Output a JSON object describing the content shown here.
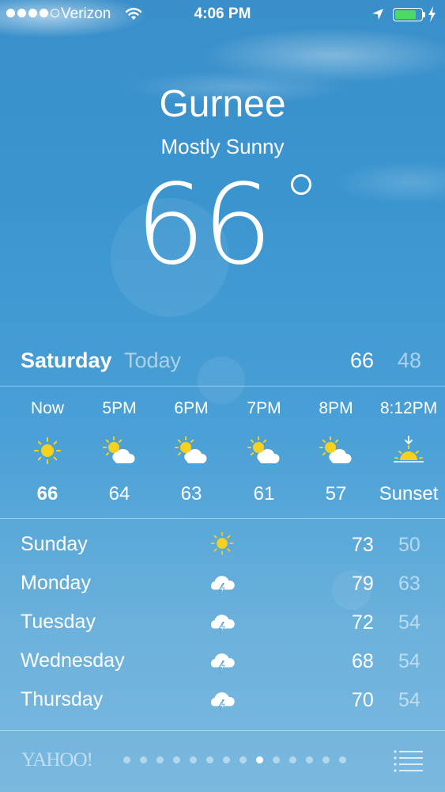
{
  "status_bar": {
    "carrier": "Verizon",
    "time": "4:06 PM",
    "battery_level": 0.85,
    "battery_color": "#4cd964",
    "signal_dots_filled": 4,
    "signal_dots_total": 5
  },
  "header": {
    "city": "Gurnee",
    "condition": "Mostly Sunny",
    "temperature": "66"
  },
  "today": {
    "day": "Saturday",
    "label": "Today",
    "high": "66",
    "low": "48"
  },
  "hourly": [
    {
      "time": "Now",
      "icon": "sun-icon",
      "value": "66"
    },
    {
      "time": "5PM",
      "icon": "partly-cloudy-icon",
      "value": "64"
    },
    {
      "time": "6PM",
      "icon": "partly-cloudy-icon",
      "value": "63"
    },
    {
      "time": "7PM",
      "icon": "partly-cloudy-icon",
      "value": "61"
    },
    {
      "time": "8PM",
      "icon": "partly-cloudy-icon",
      "value": "57"
    },
    {
      "time": "8:12PM",
      "icon": "sunset-icon",
      "value": "Sunset"
    }
  ],
  "daily": [
    {
      "day": "Sunday",
      "icon": "sun-icon",
      "high": "73",
      "low": "50"
    },
    {
      "day": "Monday",
      "icon": "thunderstorm-icon",
      "high": "79",
      "low": "63"
    },
    {
      "day": "Tuesday",
      "icon": "thunderstorm-icon",
      "high": "72",
      "low": "54"
    },
    {
      "day": "Wednesday",
      "icon": "thunderstorm-icon",
      "high": "68",
      "low": "54"
    },
    {
      "day": "Thursday",
      "icon": "thunderstorm-icon",
      "high": "70",
      "low": "54"
    }
  ],
  "footer": {
    "brand": "YAHOO!",
    "page_count": 14,
    "active_page": 9
  },
  "colors": {
    "sun": "#f7d11e",
    "sky_top": "#3a8fca",
    "sky_bottom": "#7ab8de"
  }
}
